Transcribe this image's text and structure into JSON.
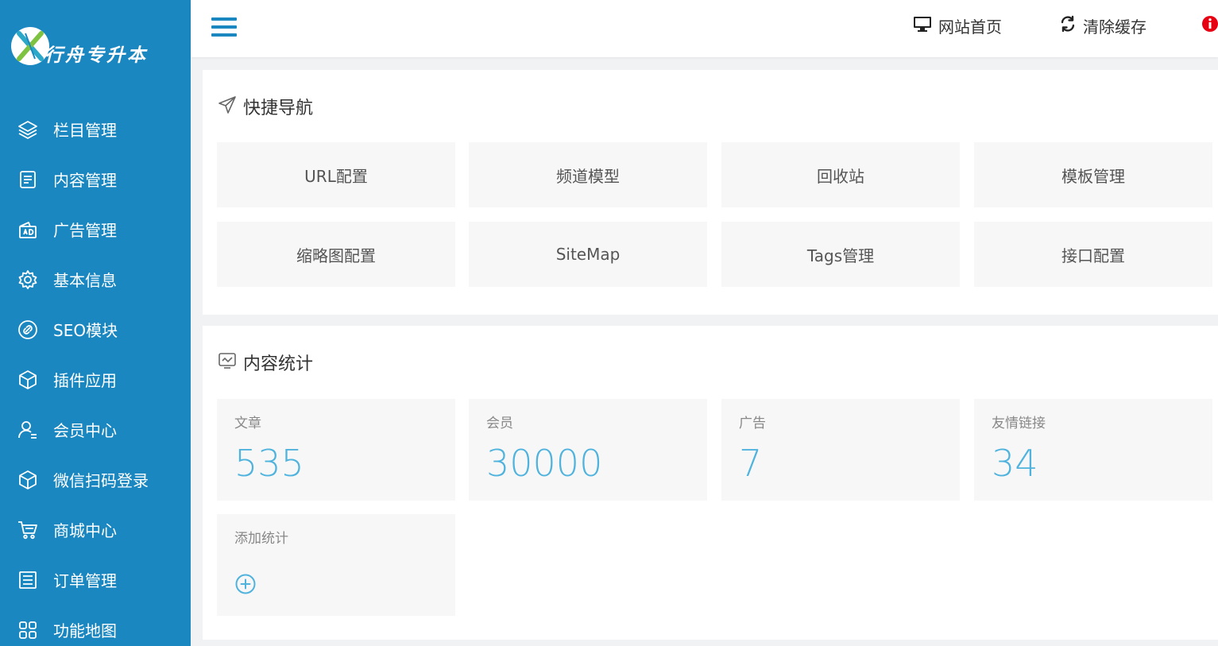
{
  "brand": {
    "name": "行舟专升本"
  },
  "sidebar": {
    "items": [
      {
        "label": "栏目管理",
        "icon": "layers-icon"
      },
      {
        "label": "内容管理",
        "icon": "document-icon"
      },
      {
        "label": "广告管理",
        "icon": "ad-icon"
      },
      {
        "label": "基本信息",
        "icon": "gear-icon"
      },
      {
        "label": "SEO模块",
        "icon": "link-icon"
      },
      {
        "label": "插件应用",
        "icon": "cube-icon"
      },
      {
        "label": "会员中心",
        "icon": "user-icon"
      },
      {
        "label": "微信扫码登录",
        "icon": "cube-icon"
      },
      {
        "label": "商城中心",
        "icon": "cart-icon"
      },
      {
        "label": "订单管理",
        "icon": "list-icon"
      },
      {
        "label": "功能地图",
        "icon": "grid-icon"
      }
    ]
  },
  "header": {
    "site_home": "网站首页",
    "clear_cache": "清除缓存"
  },
  "quick_nav": {
    "title": "快捷导航",
    "tiles": [
      "URL配置",
      "频道模型",
      "回收站",
      "模板管理",
      "缩略图配置",
      "SiteMap",
      "Tags管理",
      "接口配置"
    ]
  },
  "stats": {
    "title": "内容统计",
    "items": [
      {
        "label": "文章",
        "value": "535"
      },
      {
        "label": "会员",
        "value": "30000"
      },
      {
        "label": "广告",
        "value": "7"
      },
      {
        "label": "友情链接",
        "value": "34"
      }
    ],
    "add_label": "添加统计"
  },
  "colors": {
    "sidebar": "#1a87c0",
    "accent": "#4fb3dd",
    "alert": "#e60012"
  }
}
